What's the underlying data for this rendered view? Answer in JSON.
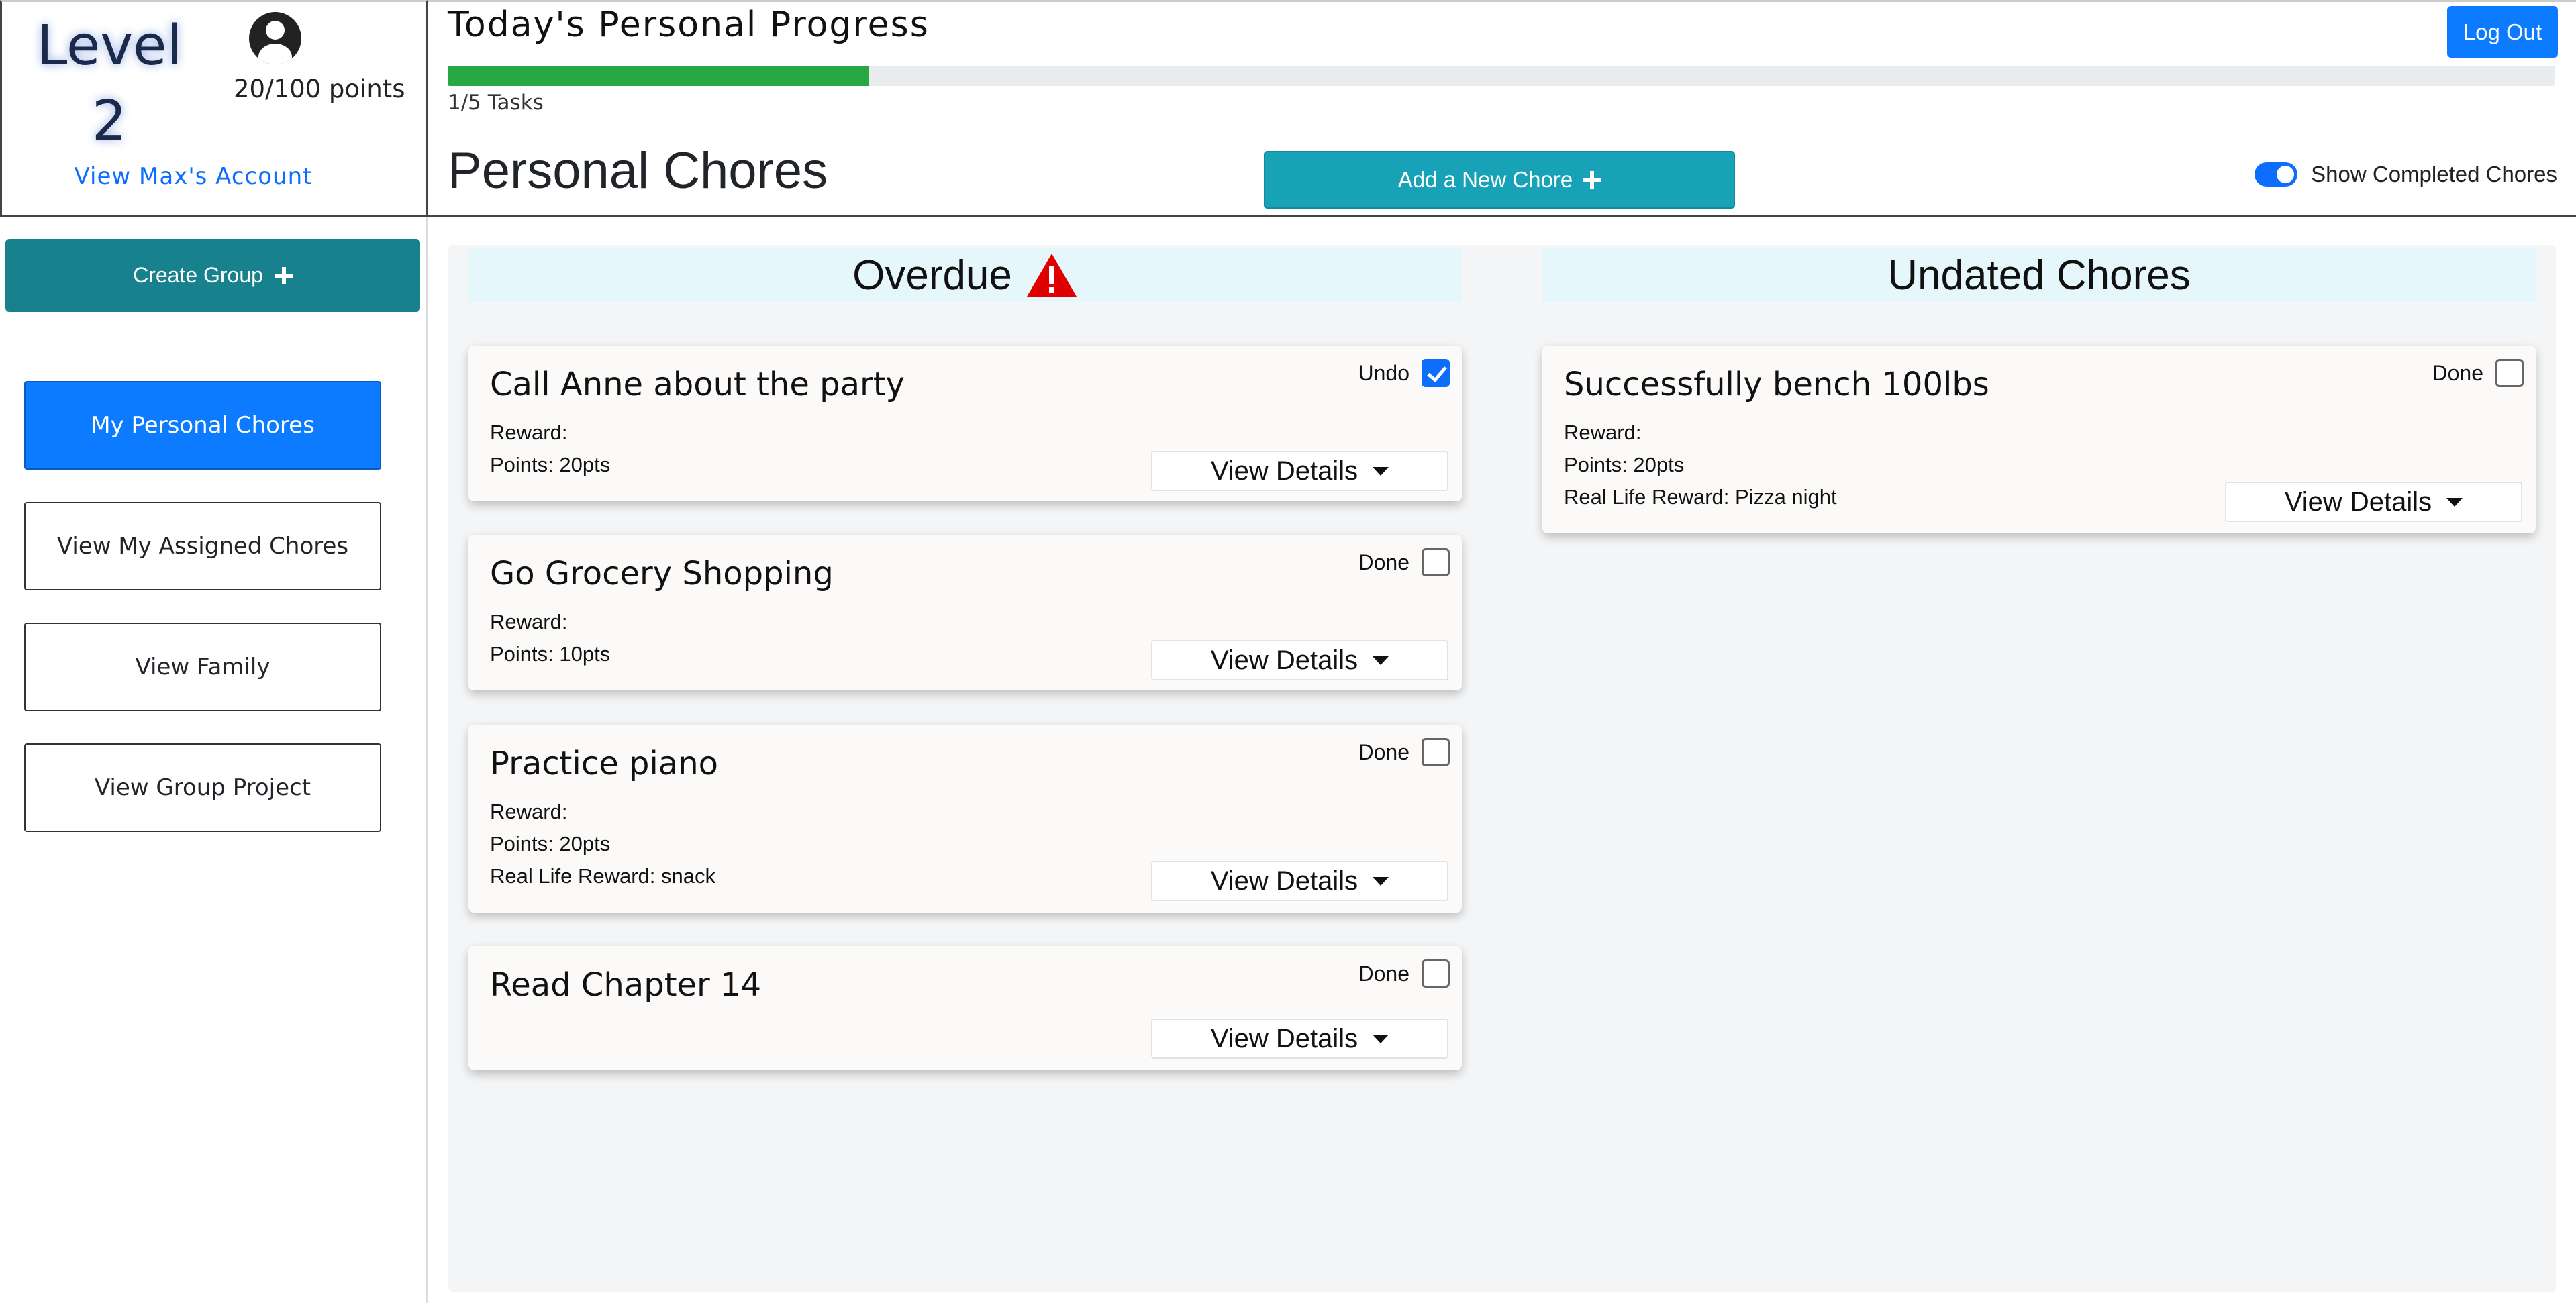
{
  "user": {
    "level_label": "Level",
    "level_value": "2",
    "points": "20/100 points",
    "account_link": "View Max's Account"
  },
  "sidebar": {
    "create_group": "Create Group",
    "items": [
      {
        "label": "My Personal Chores",
        "active": true
      },
      {
        "label": "View My Assigned Chores",
        "active": false
      },
      {
        "label": "View Family",
        "active": false
      },
      {
        "label": "View Group Project",
        "active": false
      }
    ]
  },
  "header": {
    "progress_title": "Today's Personal Progress",
    "logout": "Log Out",
    "progress_fraction": 0.2,
    "tasks_text": "1/5 Tasks",
    "page_title": "Personal Chores",
    "add_chore": "Add a New Chore",
    "show_completed": "Show Completed Chores",
    "show_completed_on": true
  },
  "columns": {
    "overdue": {
      "title": "Overdue",
      "cards": [
        {
          "title": "Call Anne about the party",
          "lines": [
            "Reward:",
            "Points: 20pts"
          ],
          "action": "Undo",
          "checked": true,
          "details": "View Details"
        },
        {
          "title": "Go Grocery Shopping",
          "lines": [
            "Reward:",
            "Points: 10pts"
          ],
          "action": "Done",
          "checked": false,
          "details": "View Details"
        },
        {
          "title": "Practice piano",
          "lines": [
            "Reward:",
            "Points: 20pts",
            "Real Life Reward: snack"
          ],
          "action": "Done",
          "checked": false,
          "details": "View Details"
        },
        {
          "title": "Read Chapter 14",
          "lines": [],
          "action": "Done",
          "checked": false,
          "details": "View Details"
        }
      ]
    },
    "undated": {
      "title": "Undated Chores",
      "cards": [
        {
          "title": "Successfully bench 100lbs",
          "lines": [
            "Reward:",
            "Points: 20pts",
            "Real Life Reward: Pizza night"
          ],
          "action": "Done",
          "checked": false,
          "details": "View Details"
        }
      ]
    }
  },
  "colors": {
    "primary": "#0d7bff",
    "teal": "#17818e",
    "progress": "#28a745",
    "warning": "#e00000"
  }
}
